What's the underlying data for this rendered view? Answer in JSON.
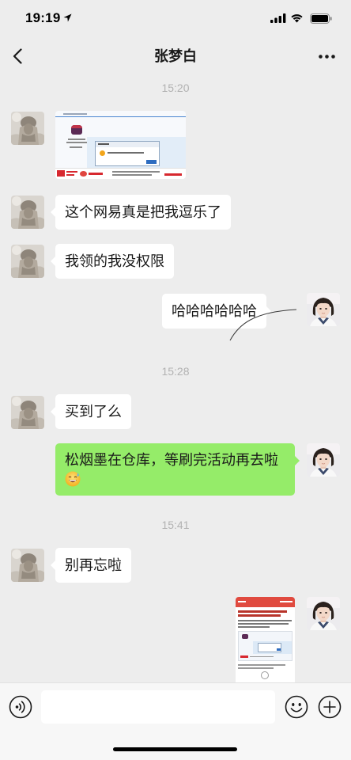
{
  "status_bar": {
    "time": "19:19",
    "icons": [
      "location-arrow-icon",
      "cellular-signal-icon",
      "wifi-icon",
      "battery-icon"
    ]
  },
  "header": {
    "title": "张梦白",
    "back_icon": "chevron-left-icon",
    "more_icon": "more-dots-icon"
  },
  "chat": [
    {
      "timestamp": "15:20"
    },
    {
      "incoming_image": true
    },
    {
      "incoming_text": "这个网易真是把我逗乐了"
    },
    {
      "incoming_text": "我领的我没权限"
    },
    {
      "outgoing_text": "哈哈哈哈哈哈"
    },
    {
      "timestamp": "15:28"
    },
    {
      "incoming_text": "买到了么"
    },
    {
      "outgoing_text": "松烟墨在仓库，等刷完活动再去啦",
      "emoji_icon": "grinning-face-with-sweat-emoji"
    },
    {
      "timestamp": "15:41"
    },
    {
      "incoming_text": "别再忘啦"
    },
    {
      "outgoing_image": true
    }
  ],
  "input_bar": {
    "value": "",
    "voice_icon": "voice-input-icon",
    "emoji_icon": "emoji-icon",
    "plus_icon": "plus-circle-icon"
  },
  "colors": {
    "chat_background": "#ededed",
    "incoming_bubble": "#ffffff",
    "outgoing_bubble": "#95ec69",
    "input_bar_background": "#f7f7f7",
    "timestamp_text": "#b2b2b2"
  }
}
